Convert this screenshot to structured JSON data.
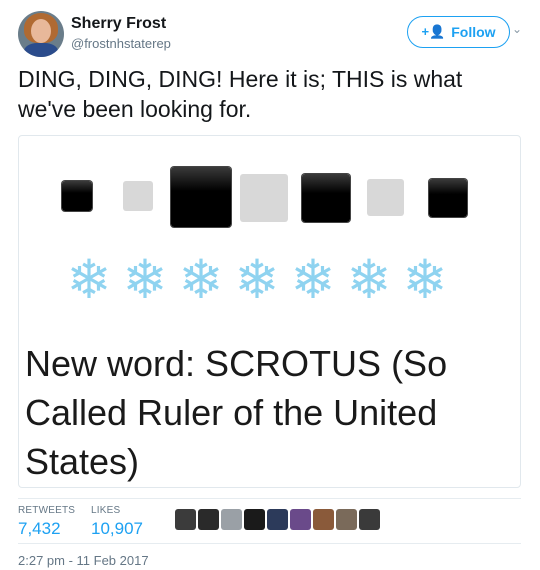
{
  "header": {
    "display_name": "Sherry Frost",
    "handle": "@frostnhstaterep",
    "follow_label": "Follow"
  },
  "tweet": {
    "text": "DING, DING, DING!  Here it is; THIS is what we've been looking for."
  },
  "media": {
    "image_text": "New word: SCROTUS (So Called Ruler of the United States)",
    "squares": [
      "black",
      "grey",
      "black",
      "grey",
      "black",
      "grey",
      "black"
    ],
    "snowflake_count": 7
  },
  "stats": {
    "retweets_label": "RETWEETS",
    "retweets_value": "7,432",
    "likes_label": "LIKES",
    "likes_value": "10,907",
    "liker_avatar_colors": [
      "#3b3b3b",
      "#2a2a2a",
      "#9aa0a6",
      "#1a1a1a",
      "#2c3a5a",
      "#6a4a8a",
      "#8a5a3a",
      "#7a6a5a",
      "#3a3a3a"
    ]
  },
  "footer": {
    "timestamp": "2:27 pm - 11 Feb 2017"
  },
  "colors": {
    "accent": "#1da1f2",
    "muted": "#657786",
    "text": "#14171a"
  }
}
